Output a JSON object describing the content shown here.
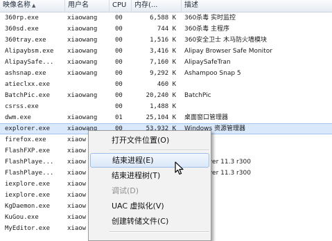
{
  "columns": {
    "name": "映像名称",
    "user": "用户名",
    "cpu": "CPU",
    "mem": "内存(...",
    "desc": "描述"
  },
  "processes": [
    {
      "name": "360rp.exe",
      "user": "xiaowang",
      "cpu": "00",
      "mem": "6,588 K",
      "desc": "360杀毒 实时监控"
    },
    {
      "name": "360sd.exe",
      "user": "xiaowang",
      "cpu": "00",
      "mem": "744 K",
      "desc": "360杀毒 主程序"
    },
    {
      "name": "360tray.exe",
      "user": "xiaowang",
      "cpu": "00",
      "mem": "1,516 K",
      "desc": "360安全卫士 木马防火墙模块"
    },
    {
      "name": "Alipaybsm.exe",
      "user": "xiaowang",
      "cpu": "00",
      "mem": "3,416 K",
      "desc": "Alipay Browser Safe Monitor"
    },
    {
      "name": "AlipaySafe...",
      "user": "xiaowang",
      "cpu": "00",
      "mem": "7,160 K",
      "desc": "AlipaySafeTran"
    },
    {
      "name": "ashsnap.exe",
      "user": "xiaowang",
      "cpu": "00",
      "mem": "9,292 K",
      "desc": "Ashampoo Snap 5"
    },
    {
      "name": "atieclxx.exe",
      "user": "",
      "cpu": "00",
      "mem": "460 K",
      "desc": ""
    },
    {
      "name": "BatchPic.exe",
      "user": "xiaowang",
      "cpu": "00",
      "mem": "20,240 K",
      "desc": "BatchPic"
    },
    {
      "name": "csrss.exe",
      "user": "",
      "cpu": "00",
      "mem": "1,488 K",
      "desc": ""
    },
    {
      "name": "dwm.exe",
      "user": "xiaowang",
      "cpu": "01",
      "mem": "25,104 K",
      "desc": "桌面窗口管理器"
    },
    {
      "name": "explorer.exe",
      "user": "xiaowang",
      "cpu": "00",
      "mem": "53,932 K",
      "desc": "Windows 资源管理器"
    },
    {
      "name": "firefox.exe",
      "user": "xiaow",
      "cpu": "",
      "mem": "",
      "desc": ""
    },
    {
      "name": "FlashFXP.exe",
      "user": "xiaow",
      "cpu": "",
      "mem": "",
      "desc": "P"
    },
    {
      "name": "FlashPlaye...",
      "user": "xiaow",
      "cpu": "",
      "mem": "",
      "desc": "lash Player 11.3 r300"
    },
    {
      "name": "FlashPlaye...",
      "user": "xiaow",
      "cpu": "",
      "mem": "",
      "desc": "lash Player 11.3 r300"
    },
    {
      "name": "iexplore.exe",
      "user": "xiaow",
      "cpu": "",
      "mem": "",
      "desc": ""
    },
    {
      "name": "iexplore.exe",
      "user": "xiaow",
      "cpu": "",
      "mem": "",
      "desc": ""
    },
    {
      "name": "KgDaemon.exe",
      "user": "xiaow",
      "cpu": "",
      "mem": "",
      "desc": ""
    },
    {
      "name": "KuGou.exe",
      "user": "xiaow",
      "cpu": "",
      "mem": "",
      "desc": ""
    },
    {
      "name": "MyEditor.exe",
      "user": "xiaow",
      "cpu": "",
      "mem": "",
      "desc": ""
    }
  ],
  "selected_row": 10,
  "context_menu": {
    "items": [
      {
        "label": "打开文件位置(O)",
        "state": "normal"
      },
      {
        "label": "结束进程(E)",
        "state": "highlight"
      },
      {
        "label": "结束进程树(T)",
        "state": "normal"
      },
      {
        "label": "调试(D)",
        "state": "disabled"
      },
      {
        "label": "UAC 虚拟化(V)",
        "state": "normal"
      },
      {
        "label": "创建转储文件(C)",
        "state": "normal"
      }
    ]
  },
  "colors": {
    "selection": "#d9e8fb",
    "menu_background": "#f2f2f2",
    "menu_highlight": "#dbe8f9"
  }
}
